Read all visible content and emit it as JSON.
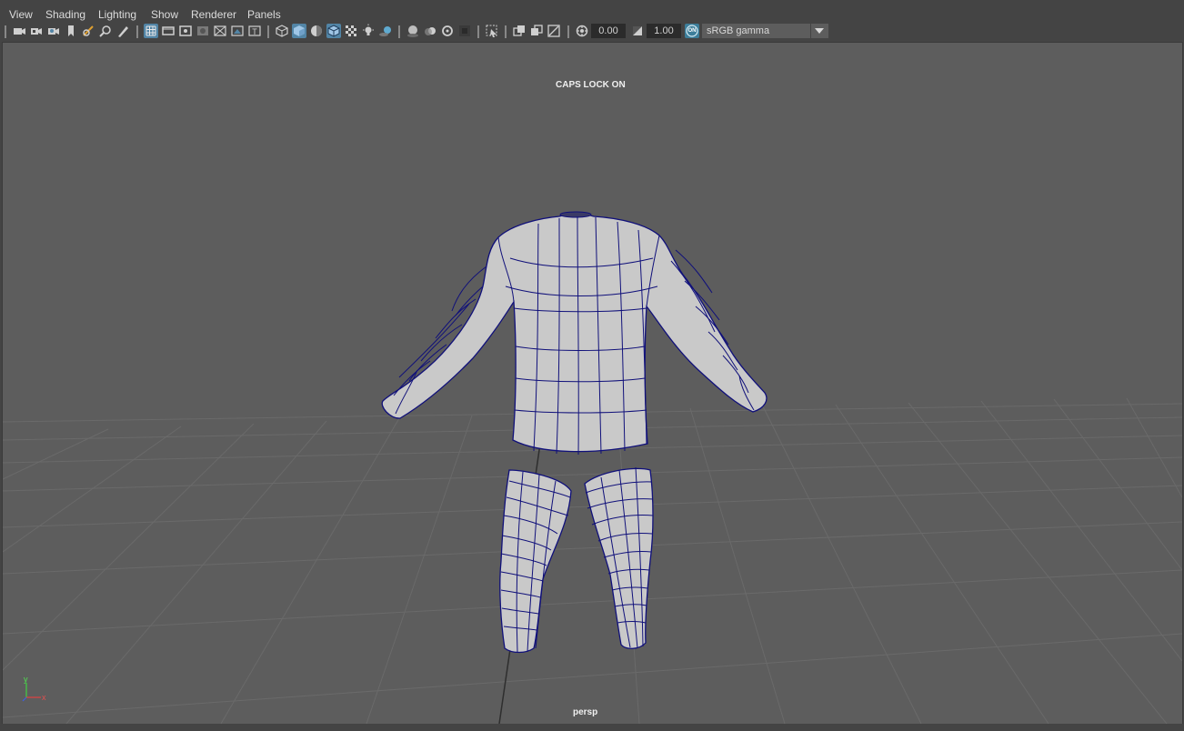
{
  "menubar": {
    "items": [
      {
        "label": "View"
      },
      {
        "label": "Shading"
      },
      {
        "label": "Lighting"
      },
      {
        "label": "Show"
      },
      {
        "label": "Renderer"
      },
      {
        "label": "Panels"
      }
    ]
  },
  "toolbar": {
    "icons": [
      "select-camera-icon",
      "camera-attributes-icon",
      "bookmarks-icon",
      "image-plane-icon",
      "2d-pan-zoom-icon",
      "grease-pencil-icon",
      "grid-icon",
      "film-gate-icon",
      "resolution-gate-icon",
      "gate-mask-icon",
      "field-chart-icon",
      "safe-action-icon",
      "safe-title-icon",
      "wireframe-icon",
      "smooth-shade-all-icon",
      "use-default-material-icon",
      "wireframe-on-shaded-icon",
      "xray-icon",
      "use-all-lights-icon",
      "shadows-icon",
      "screen-space-ao-icon",
      "motion-blur-icon",
      "multisample-aa-icon",
      "depth-of-field-icon",
      "isolate-select-icon",
      "xray-joints-icon",
      "xray-active-components-icon",
      "backface-culling-icon"
    ],
    "active_icons": [
      "grid-icon",
      "smooth-shade-all-icon",
      "wireframe-on-shaded-icon"
    ],
    "exposure_value": "0.00",
    "gamma_value": "1.00",
    "color_management_badge": "ON",
    "color_space": "sRGB gamma",
    "accent_color": "#5285a6"
  },
  "viewport": {
    "hud_caps_lock": "CAPS LOCK ON",
    "camera_name": "persp",
    "axis_labels": {
      "y": "y",
      "x": "x"
    },
    "background_color": "#5d5d5d",
    "wire_color": "#0a0a8c",
    "mesh_color": "#c9c9c9"
  }
}
